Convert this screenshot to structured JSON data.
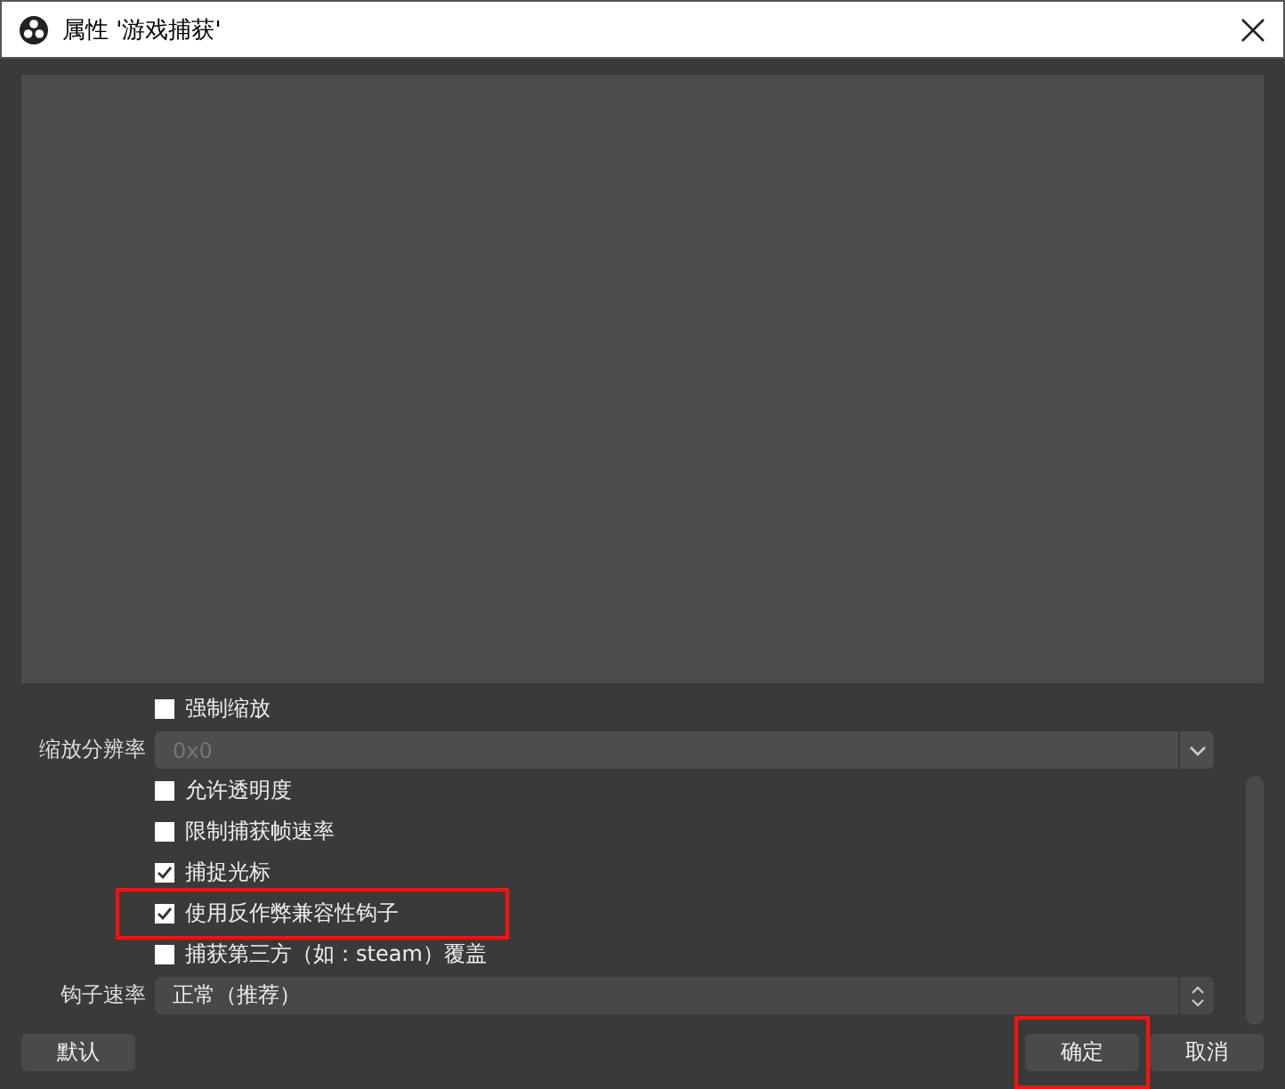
{
  "window": {
    "title": "属性 '游戏捕获'"
  },
  "settings": [
    {
      "kind": "checkbox",
      "text": "强制缩放",
      "checked": false,
      "highlighted": false
    },
    {
      "kind": "select",
      "label": "缩放分辨率",
      "value": "0x0",
      "disabled": true
    },
    {
      "kind": "checkbox",
      "text": "允许透明度",
      "checked": false,
      "highlighted": false
    },
    {
      "kind": "checkbox",
      "text": "限制捕获帧速率",
      "checked": false,
      "highlighted": false
    },
    {
      "kind": "checkbox",
      "text": "捕捉光标",
      "checked": true,
      "highlighted": false
    },
    {
      "kind": "checkbox",
      "text": "使用反作弊兼容性钩子",
      "checked": true,
      "highlighted": true
    },
    {
      "kind": "checkbox",
      "text": "捕获第三方（如：steam）覆盖",
      "checked": false,
      "highlighted": false
    },
    {
      "kind": "spin",
      "label": "钩子速率",
      "value": "正常（推荐）",
      "disabled": false
    }
  ],
  "buttons": [
    {
      "label": "默认",
      "highlighted": false
    },
    {
      "label": "确定",
      "highlighted": true
    },
    {
      "label": "取消",
      "highlighted": false
    }
  ]
}
